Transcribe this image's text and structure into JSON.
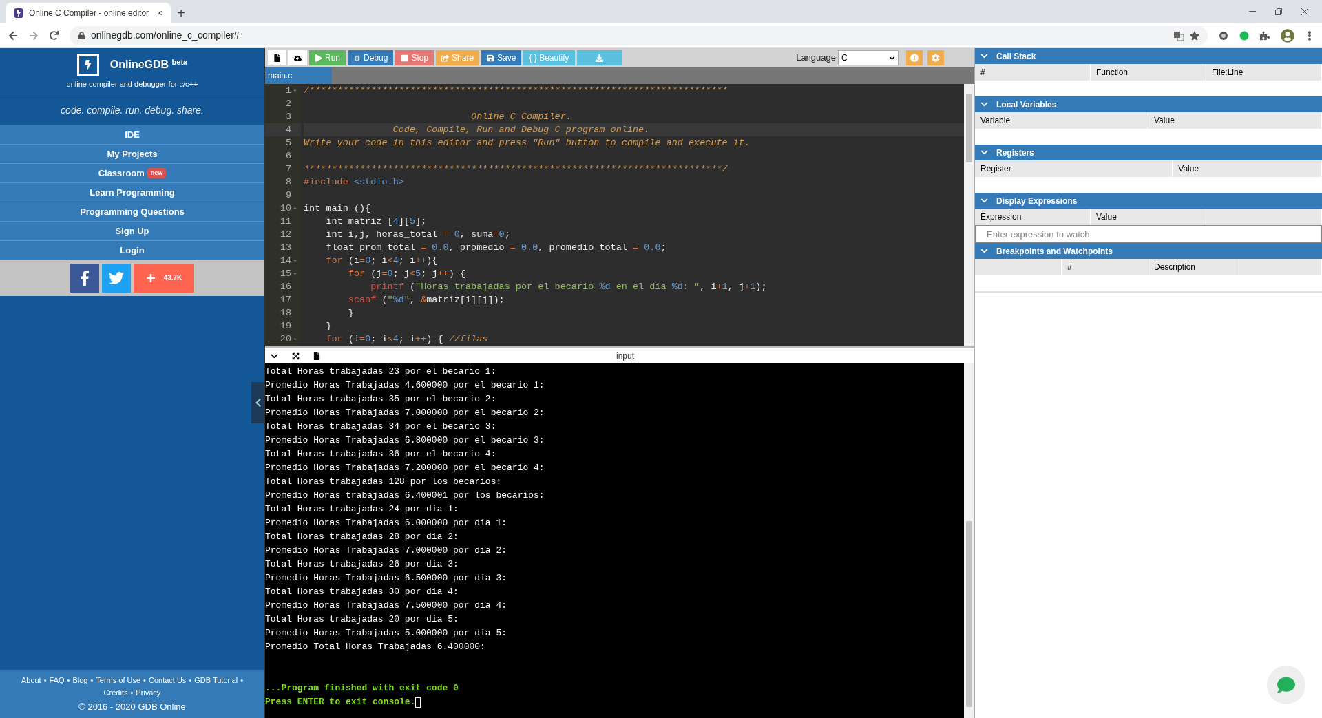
{
  "browser": {
    "tab_title": "Online C Compiler - online editor",
    "tab_close": "×",
    "new_tab": "+",
    "url": "onlinegdb.com/online_c_compiler#"
  },
  "sidebar": {
    "brand": "OnlineGDB",
    "brand_sup": "beta",
    "subtitle": "online compiler and debugger for c/c++",
    "tagline": "code. compile. run. debug. share.",
    "nav": [
      {
        "label": "IDE"
      },
      {
        "label": "My Projects"
      },
      {
        "label": "Classroom",
        "badge": "new"
      },
      {
        "label": "Learn Programming"
      },
      {
        "label": "Programming Questions"
      },
      {
        "label": "Sign Up"
      },
      {
        "label": "Login"
      }
    ],
    "share_count": "43.7K",
    "footer_links": [
      [
        "About",
        "FAQ",
        "Blog",
        "Terms of Use",
        "Contact Us",
        "GDB Tutorial"
      ],
      [
        "Credits",
        "Privacy"
      ]
    ],
    "separator": "•",
    "copyright": "© 2016 - 2020 GDB Online"
  },
  "toolbar": {
    "buttons": [
      {
        "kind": "new-file",
        "color": "#ffffff"
      },
      {
        "kind": "upload",
        "color": "#ffffff"
      },
      {
        "kind": "run",
        "label": "Run",
        "color": "#5cb85c"
      },
      {
        "kind": "debug",
        "label": "Debug",
        "color": "#337ab7"
      },
      {
        "kind": "stop",
        "label": "Stop",
        "color": "#e37774"
      },
      {
        "kind": "share",
        "label": "Share",
        "color": "#f0ad4e"
      },
      {
        "kind": "save",
        "label": "Save",
        "color": "#337ab7"
      },
      {
        "kind": "beautify",
        "label": "{ } Beautify",
        "color": "#5bc0de"
      },
      {
        "kind": "download",
        "color": "#5bc0de"
      }
    ],
    "language_label": "Language",
    "language_value": "C"
  },
  "editor": {
    "file_tab": "main.c",
    "lines": [
      {
        "n": "1",
        "fold": true,
        "active": false,
        "tokens": [
          {
            "kind": "comment",
            "text": "/***************************************************************************"
          }
        ]
      },
      {
        "n": "2",
        "fold": false,
        "active": false
      },
      {
        "n": "3",
        "fold": false,
        "active": false,
        "tokens": [
          {
            "kind": "comment",
            "text": "                              Online C Compiler."
          }
        ]
      },
      {
        "n": "4",
        "fold": false,
        "active": true,
        "tokens": [
          {
            "kind": "comment",
            "text": "                Code, Compile, Run and Debug C program online."
          }
        ]
      },
      {
        "n": "5",
        "fold": false,
        "active": false,
        "tokens": [
          {
            "kind": "comment",
            "text": "Write your code in this editor and press \"Run\" button to compile and execute it."
          }
        ]
      },
      {
        "n": "6",
        "fold": false,
        "active": false
      },
      {
        "n": "7",
        "fold": false,
        "active": false,
        "tokens": [
          {
            "kind": "comment",
            "text": "***************************************************************************/"
          }
        ]
      },
      {
        "n": "8",
        "fold": false,
        "active": false,
        "tokens": [
          {
            "kind": "keyword",
            "text": "#include "
          },
          {
            "kind": "number",
            "text": "<stdio.h>"
          }
        ]
      },
      {
        "n": "9",
        "fold": false,
        "active": false
      },
      {
        "n": "10",
        "fold": true,
        "active": false,
        "tokens": [
          {
            "kind": "plain",
            "text": "int main (){"
          }
        ]
      },
      {
        "n": "11",
        "fold": false,
        "active": false,
        "tokens": [
          {
            "kind": "plain",
            "text": "    int matriz ["
          },
          {
            "kind": "number",
            "text": "4"
          },
          {
            "kind": "plain",
            "text": "]["
          },
          {
            "kind": "number",
            "text": "5"
          },
          {
            "kind": "plain",
            "text": "];"
          }
        ]
      },
      {
        "n": "12",
        "fold": false,
        "active": false,
        "tokens": [
          {
            "kind": "plain",
            "text": "    int i,j, horas_total "
          },
          {
            "kind": "keyword",
            "text": "="
          },
          {
            "kind": "number",
            "text": " 0"
          },
          {
            "kind": "plain",
            "text": ", suma"
          },
          {
            "kind": "keyword",
            "text": "="
          },
          {
            "kind": "number",
            "text": "0"
          },
          {
            "kind": "plain",
            "text": ";"
          }
        ]
      },
      {
        "n": "13",
        "fold": false,
        "active": false,
        "tokens": [
          {
            "kind": "plain",
            "text": "    float prom_total "
          },
          {
            "kind": "keyword",
            "text": "="
          },
          {
            "kind": "number",
            "text": " 0.0"
          },
          {
            "kind": "plain",
            "text": ", promedio "
          },
          {
            "kind": "keyword",
            "text": "="
          },
          {
            "kind": "number",
            "text": " 0.0"
          },
          {
            "kind": "plain",
            "text": ", promedio_total "
          },
          {
            "kind": "keyword",
            "text": "="
          },
          {
            "kind": "number",
            "text": " 0.0"
          },
          {
            "kind": "plain",
            "text": ";"
          }
        ]
      },
      {
        "n": "14",
        "fold": true,
        "active": false,
        "tokens": [
          {
            "kind": "keyword",
            "text": "    for"
          },
          {
            "kind": "plain",
            "text": " (i"
          },
          {
            "kind": "keyword",
            "text": "="
          },
          {
            "kind": "number",
            "text": "0"
          },
          {
            "kind": "plain",
            "text": "; i"
          },
          {
            "kind": "keyword",
            "text": "<"
          },
          {
            "kind": "number",
            "text": "4"
          },
          {
            "kind": "plain",
            "text": "; i"
          },
          {
            "kind": "keyword",
            "text": "++"
          },
          {
            "kind": "plain",
            "text": "){"
          }
        ]
      },
      {
        "n": "15",
        "fold": true,
        "active": false,
        "tokens": [
          {
            "kind": "keyword",
            "text": "        for"
          },
          {
            "kind": "plain",
            "text": " (j"
          },
          {
            "kind": "keyword",
            "text": "="
          },
          {
            "kind": "number",
            "text": "0"
          },
          {
            "kind": "plain",
            "text": "; j"
          },
          {
            "kind": "keyword",
            "text": "<"
          },
          {
            "kind": "number",
            "text": "5"
          },
          {
            "kind": "plain",
            "text": "; j"
          },
          {
            "kind": "keyword",
            "text": "++"
          },
          {
            "kind": "plain",
            "text": ") {"
          }
        ]
      },
      {
        "n": "16",
        "fold": false,
        "active": false,
        "tokens": [
          {
            "kind": "function",
            "text": "            printf"
          },
          {
            "kind": "plain",
            "text": " ("
          },
          {
            "kind": "string",
            "text": "\"Horas trabajadas por el becario "
          },
          {
            "kind": "number",
            "text": "%d"
          },
          {
            "kind": "string",
            "text": " en el dia "
          },
          {
            "kind": "number",
            "text": "%d"
          },
          {
            "kind": "string",
            "text": ": \""
          },
          {
            "kind": "plain",
            "text": ", i"
          },
          {
            "kind": "keyword",
            "text": "+"
          },
          {
            "kind": "number",
            "text": "1"
          },
          {
            "kind": "plain",
            "text": ", j"
          },
          {
            "kind": "keyword",
            "text": "+"
          },
          {
            "kind": "number",
            "text": "1"
          },
          {
            "kind": "plain",
            "text": ");"
          }
        ]
      },
      {
        "n": "17",
        "fold": false,
        "active": false,
        "tokens": [
          {
            "kind": "function",
            "text": "        scanf"
          },
          {
            "kind": "plain",
            "text": " ("
          },
          {
            "kind": "string",
            "text": "\""
          },
          {
            "kind": "number",
            "text": "%d"
          },
          {
            "kind": "string",
            "text": "\""
          },
          {
            "kind": "plain",
            "text": ", "
          },
          {
            "kind": "keyword",
            "text": "&"
          },
          {
            "kind": "plain",
            "text": "matriz[i][j]);"
          }
        ]
      },
      {
        "n": "18",
        "fold": false,
        "active": false,
        "tokens": [
          {
            "kind": "plain",
            "text": "        }"
          }
        ]
      },
      {
        "n": "19",
        "fold": false,
        "active": false,
        "tokens": [
          {
            "kind": "plain",
            "text": "    }"
          }
        ]
      },
      {
        "n": "20",
        "fold": true,
        "active": false,
        "tokens": [
          {
            "kind": "keyword",
            "text": "    for"
          },
          {
            "kind": "plain",
            "text": " (i"
          },
          {
            "kind": "keyword",
            "text": "="
          },
          {
            "kind": "number",
            "text": "0"
          },
          {
            "kind": "plain",
            "text": "; i"
          },
          {
            "kind": "keyword",
            "text": "<"
          },
          {
            "kind": "number",
            "text": "4"
          },
          {
            "kind": "plain",
            "text": "; i"
          },
          {
            "kind": "keyword",
            "text": "++"
          },
          {
            "kind": "plain",
            "text": ") { "
          },
          {
            "kind": "comment",
            "text": "//filas"
          }
        ]
      }
    ]
  },
  "console": {
    "title": "input",
    "output": [
      "Total Horas trabajadas 23 por el becario 1:",
      "Promedio Horas Trabajadas 4.600000 por el becario 1:",
      "Total Horas trabajadas 35 por el becario 2:",
      "Promedio Horas Trabajadas 7.000000 por el becario 2:",
      "Total Horas trabajadas 34 por el becario 3:",
      "Promedio Horas Trabajadas 6.800000 por el becario 3:",
      "Total Horas trabajadas 36 por el becario 4:",
      "Promedio Horas Trabajadas 7.200000 por el becario 4:",
      "Total Horas trabajadas 128 por los becarios:",
      "Promedio Horas trabajadas 6.400001 por los becarios:",
      "Total Horas trabajadas 24 por dia 1:",
      "Promedio Horas Trabajadas 6.000000 por dia 1:",
      "Total Horas trabajadas 28 por dia 2:",
      "Promedio Horas Trabajadas 7.000000 por dia 2:",
      "Total Horas trabajadas 26 por dia 3:",
      "Promedio Horas Trabajadas 6.500000 por dia 3:",
      "Total Horas trabajadas 30 por dia 4:",
      "Promedio Horas Trabajadas 7.500000 por dia 4:",
      "Total Horas trabajadas 20 por dia 5:",
      "Promedio Horas Trabajadas 5.000000 por dia 5:",
      "Promedio Total Horas Trabajadas 6.400000:"
    ],
    "status": [
      "...Program finished with exit code 0",
      "Press ENTER to exit console."
    ],
    "cursor": true
  },
  "debug_panels": [
    {
      "title": "Call Stack",
      "kind": "three",
      "columns": [
        "#",
        "Function",
        "File:Line"
      ]
    },
    {
      "title": "Local Variables",
      "kind": "two",
      "columns": [
        "Variable",
        "Value"
      ]
    },
    {
      "title": "Registers",
      "kind": "wide",
      "columns": [
        "Register",
        "Value"
      ]
    },
    {
      "title": "Display Expressions",
      "kind": "expr",
      "columns": [
        "Expression",
        "Value"
      ],
      "placeholder": "Enter expression to watch"
    },
    {
      "title": "Breakpoints and Watchpoints",
      "kind": "breakpoints",
      "columns": [
        "#",
        "Description"
      ]
    }
  ]
}
